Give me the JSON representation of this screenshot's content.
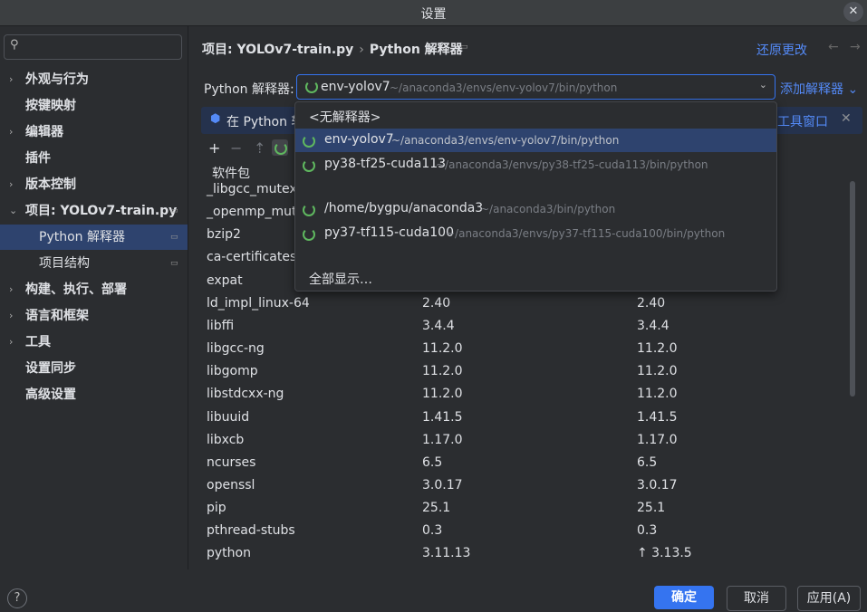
{
  "window": {
    "title": "设置",
    "close_glyph": "✕"
  },
  "search": {
    "icon": "search-icon",
    "value": ""
  },
  "sidebar": {
    "items": [
      {
        "label": "外观与行为",
        "expandable": true
      },
      {
        "label": "按键映射",
        "expandable": false
      },
      {
        "label": "编辑器",
        "expandable": true
      },
      {
        "label": "插件",
        "expandable": false
      },
      {
        "label": "版本控制",
        "expandable": true
      },
      {
        "label": "项目: YOLOv7-train.py",
        "expandable": true,
        "expanded": true
      },
      {
        "label": "Python 解释器",
        "sub": true,
        "selected": true
      },
      {
        "label": "项目结构",
        "sub": true
      },
      {
        "label": "构建、执行、部署",
        "expandable": true
      },
      {
        "label": "语言和框架",
        "expandable": true
      },
      {
        "label": "工具",
        "expandable": true
      },
      {
        "label": "设置同步",
        "expandable": false
      },
      {
        "label": "高级设置",
        "expandable": false
      }
    ]
  },
  "header": {
    "breadcrumb_project": "项目: YOLOv7-train.py",
    "breadcrumb_sep": "›",
    "breadcrumb_page": "Python 解释器",
    "restore": "还原更改",
    "back": "←",
    "forward": "→"
  },
  "interpreter": {
    "label": "Python 解释器:",
    "selected_name": "env-yolov7",
    "selected_path": "~/anaconda3/envs/env-yolov7/bin/python",
    "add_label": "添加解释器 ⌄"
  },
  "banner": {
    "text": "在 Python 软",
    "link": "工具窗口",
    "close": "✕"
  },
  "toolbar": {
    "add": "+",
    "remove": "−",
    "up": "⇡"
  },
  "table": {
    "header": "软件包",
    "rows": [
      [
        "_libgcc_mutex",
        "",
        ""
      ],
      [
        "_openmp_mut",
        "",
        ""
      ],
      [
        "bzip2",
        "",
        ""
      ],
      [
        "ca-certificates",
        "",
        ""
      ],
      [
        "expat",
        "",
        ""
      ],
      [
        "ld_impl_linux-64",
        "2.40",
        "2.40"
      ],
      [
        "libffi",
        "3.4.4",
        "3.4.4"
      ],
      [
        "libgcc-ng",
        "11.2.0",
        "11.2.0"
      ],
      [
        "libgomp",
        "11.2.0",
        "11.2.0"
      ],
      [
        "libstdcxx-ng",
        "11.2.0",
        "11.2.0"
      ],
      [
        "libuuid",
        "1.41.5",
        "1.41.5"
      ],
      [
        "libxcb",
        "1.17.0",
        "1.17.0"
      ],
      [
        "ncurses",
        "6.5",
        "6.5"
      ],
      [
        "openssl",
        "3.0.17",
        "3.0.17"
      ],
      [
        "pip",
        "25.1",
        "25.1"
      ],
      [
        "pthread-stubs",
        "0.3",
        "0.3"
      ],
      [
        "python",
        "3.11.13",
        "↑ 3.13.5"
      ]
    ]
  },
  "dropdown": {
    "no_interpreter": "<无解释器>",
    "options": [
      {
        "name": "env-yolov7",
        "path": "~/anaconda3/envs/env-yolov7/bin/python",
        "highlight": true
      },
      {
        "name": "py38-tf25-cuda113",
        "path": "~/anaconda3/envs/py38-tf25-cuda113/bin/python"
      },
      {
        "name": "/home/bygpu/anaconda3",
        "path": "~/anaconda3/bin/python"
      },
      {
        "name": "py37-tf115-cuda100",
        "path": "~/anaconda3/envs/py37-tf115-cuda100/bin/python"
      }
    ],
    "show_all": "全部显示…"
  },
  "footer": {
    "help": "?",
    "ok": "确定",
    "cancel": "取消",
    "apply": "应用(A)"
  },
  "colors": {
    "accent": "#3574f0",
    "selection": "#2e436e",
    "link": "#548af7",
    "spinner": "#5fb85f"
  }
}
